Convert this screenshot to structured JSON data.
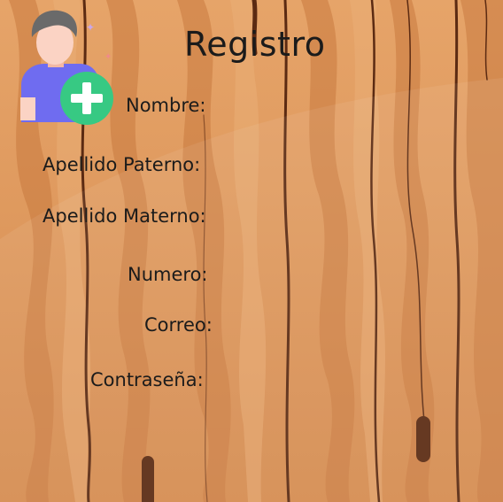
{
  "page": {
    "title": "Registro"
  },
  "form": {
    "labels": {
      "nombre": "Nombre:",
      "apellido_paterno": "Apellido Paterno:",
      "apellido_materno": "Apellido Materno:",
      "numero": "Numero:",
      "correo": "Correo:",
      "contrasena": "Contraseña:"
    }
  },
  "icons": {
    "header_icon": "add-user-icon"
  },
  "colors": {
    "wood_light": "#e8a868",
    "wood_mid": "#d98b4c",
    "wood_dark": "#c3723a",
    "grain_line": "#5b2a12",
    "plus_badge": "#37c983",
    "shirt": "#6f6cf0",
    "skin": "#fbd3c4",
    "hair": "#6a6a6a",
    "text": "#1b1b1b"
  }
}
